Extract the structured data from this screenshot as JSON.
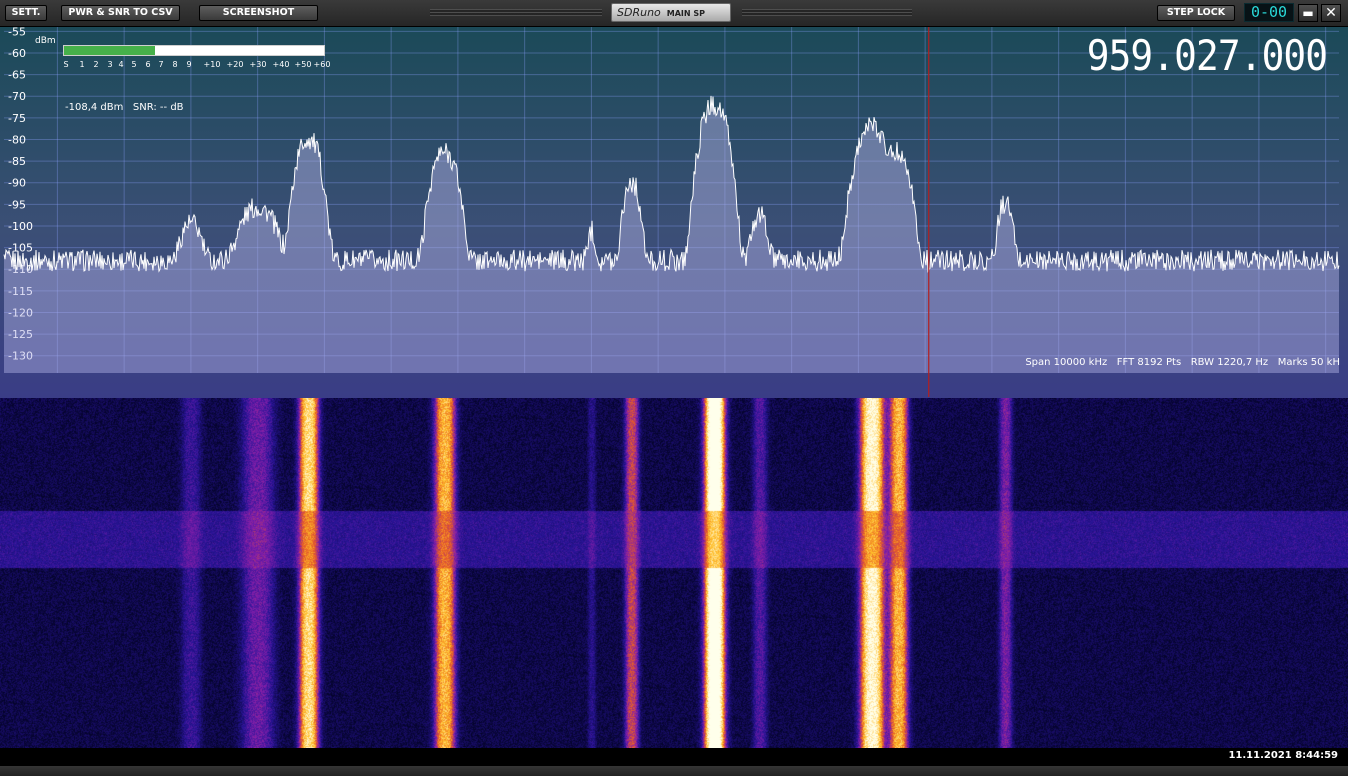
{
  "toolbar": {
    "sett_label": "SETT.",
    "csv_label": "PWR & SNR TO CSV",
    "screenshot_label": "SCREENSHOT",
    "step_lock_label": "STEP LOCK",
    "lcd_value": "0-00",
    "logo_brand": "SDRuno",
    "logo_sub": "MAIN SP"
  },
  "meter": {
    "unit": "dBm",
    "scale": [
      "S",
      "1",
      "2",
      "3",
      "4",
      "5",
      "6",
      "7",
      "8",
      "9",
      "+10",
      "+20",
      "+30",
      "+40",
      "+50",
      "+60"
    ],
    "level_fraction": 0.35,
    "readout": "-108,4 dBm   SNR: -- dB"
  },
  "frequency_display": "959.027.000",
  "info": {
    "span": "Span 10000 kHz",
    "fft": "FFT 8192 Pts",
    "rbw": "RBW 1220,7 Hz",
    "marks": "Marks 50 kH"
  },
  "timestamp": "11.11.2021 8:44:59",
  "colors": {
    "meter_fill": "#46b04a",
    "spectrum_trace": "#ffffff",
    "cursor_line": "#b41e1e",
    "freq_digits": "#ffffff",
    "lcd_digits": "#29d8d8"
  },
  "chart_data": {
    "type": "area",
    "ylabel": "dBm",
    "ylim": [
      -134,
      -54
    ],
    "xlim": [
      952100,
      962100
    ],
    "y_ticks": [
      -55,
      -60,
      -65,
      -70,
      -75,
      -80,
      -85,
      -90,
      -95,
      -100,
      -105,
      -110,
      -115,
      -120,
      -125,
      -130
    ],
    "x_ticks": [
      952500,
      953000,
      953500,
      954000,
      954500,
      955000,
      955500,
      956000,
      956500,
      957000,
      957500,
      958000,
      958500,
      959000,
      959500,
      960000,
      960500,
      961000,
      961500,
      962000
    ],
    "grid": true,
    "noise_floor_dbm": -108,
    "cursor_khz": 959027,
    "signals": [
      {
        "center_khz": 953500,
        "peak_dbm": -100,
        "width_khz": 150
      },
      {
        "center_khz": 954000,
        "peak_dbm": -96,
        "width_khz": 250
      },
      {
        "center_khz": 954380,
        "peak_dbm": -80,
        "width_khz": 160
      },
      {
        "center_khz": 955400,
        "peak_dbm": -83,
        "width_khz": 170
      },
      {
        "center_khz": 956500,
        "peak_dbm": -102,
        "width_khz": 60
      },
      {
        "center_khz": 956800,
        "peak_dbm": -90,
        "width_khz": 110
      },
      {
        "center_khz": 957420,
        "peak_dbm": -72,
        "width_khz": 170
      },
      {
        "center_khz": 957760,
        "peak_dbm": -98,
        "width_khz": 110
      },
      {
        "center_khz": 958600,
        "peak_dbm": -77,
        "width_khz": 200
      },
      {
        "center_khz": 958800,
        "peak_dbm": -83,
        "width_khz": 150
      },
      {
        "center_khz": 959600,
        "peak_dbm": -95,
        "width_khz": 100
      }
    ]
  }
}
